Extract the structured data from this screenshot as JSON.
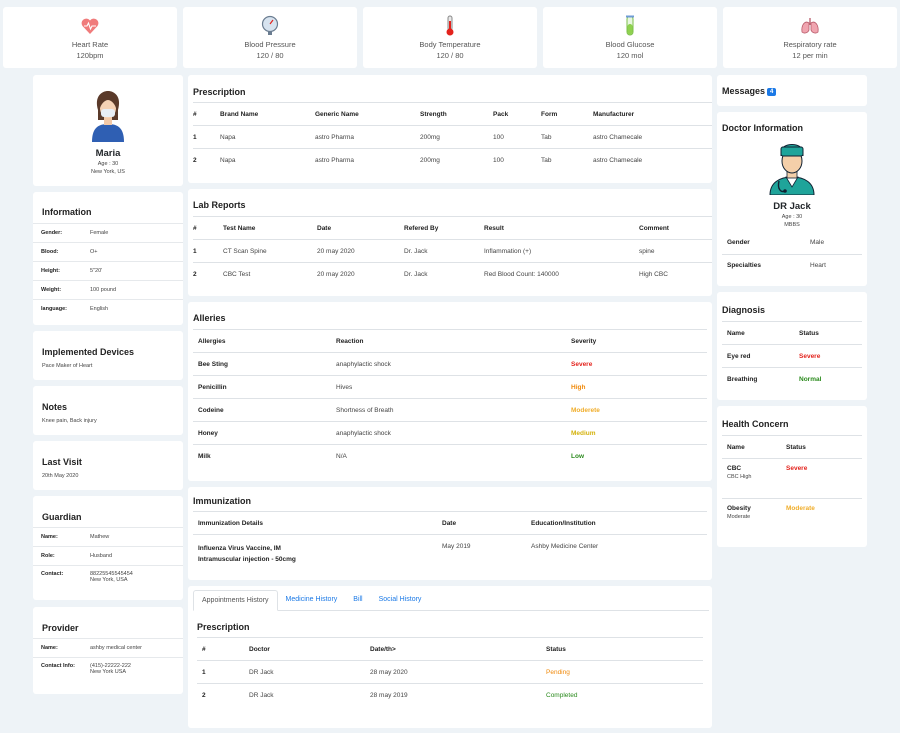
{
  "vitals": [
    {
      "label": "Heart Rate",
      "value": "120bpm",
      "icon": "heart-icon"
    },
    {
      "label": "Blood Pressure",
      "value": "120 / 80",
      "icon": "gauge-icon"
    },
    {
      "label": "Body Temperature",
      "value": "120 / 80",
      "icon": "thermometer-icon"
    },
    {
      "label": "Blood Glucose",
      "value": "120 mol",
      "icon": "test-tube-icon"
    },
    {
      "label": "Respiratory rate",
      "value": "12 per min",
      "icon": "lungs-icon"
    }
  ],
  "patient": {
    "name": "Maria",
    "age": "Age : 30",
    "location": "New York, US"
  },
  "information": {
    "title": "Information",
    "rows": [
      {
        "k": "Gender:",
        "v": "Female"
      },
      {
        "k": "Blood:",
        "v": "O+"
      },
      {
        "k": "Height:",
        "v": "5\"20'"
      },
      {
        "k": "Weight:",
        "v": "100 pound"
      },
      {
        "k": "language:",
        "v": "English"
      }
    ]
  },
  "devices": {
    "title": "Implemented Devices",
    "text": "Pace Maker of Heart"
  },
  "notes": {
    "title": "Notes",
    "text": "Knee pain, Back injury"
  },
  "last_visit": {
    "title": "Last Visit",
    "text": "20th May 2020"
  },
  "guardian": {
    "title": "Guardian",
    "rows": [
      {
        "k": "Name:",
        "v": "Mathew"
      },
      {
        "k": "Role:",
        "v": "Husband"
      },
      {
        "k": "Contact:",
        "v": "88225545545454",
        "v2": "New York, USA"
      }
    ]
  },
  "provider": {
    "title": "Provider",
    "rows": [
      {
        "k": "Name:",
        "v": "ashby medical center"
      },
      {
        "k": "Contact Info:",
        "v": "(415)-22222-222",
        "v2": "New York USA"
      }
    ]
  },
  "prescription": {
    "title": "Prescription",
    "headers": [
      "#",
      "Brand Name",
      "Generic Name",
      "Strength",
      "Pack",
      "Form",
      "Manufacturer"
    ],
    "rows": [
      [
        "1",
        "Napa",
        "astro Pharma",
        "200mg",
        "100",
        "Tab",
        "astro Chamecale"
      ],
      [
        "2",
        "Napa",
        "astro Pharma",
        "200mg",
        "100",
        "Tab",
        "astro Chamecale"
      ]
    ]
  },
  "lab": {
    "title": "Lab Reports",
    "headers": [
      "#",
      "Test Name",
      "Date",
      "Refered By",
      "Result",
      "Comment"
    ],
    "rows": [
      [
        "1",
        "CT Scan Spine",
        "20 may 2020",
        "Dr. Jack",
        "Inflammation (+)",
        "spine"
      ],
      [
        "2",
        "CBC Test",
        "20 may 2020",
        "Dr. Jack",
        "Red Blood Count: 140000",
        "High CBC"
      ]
    ]
  },
  "allergies": {
    "title": "Alleries",
    "headers": [
      "Allergies",
      "Reaction",
      "Severity"
    ],
    "rows": [
      {
        "name": "Bee Sting",
        "reaction": "anaphylactic shock",
        "severity": "Severe"
      },
      {
        "name": "Penicillin",
        "reaction": "Hives",
        "severity": "High"
      },
      {
        "name": "Codeine",
        "reaction": "Shortness of Breath",
        "severity": "Moderete"
      },
      {
        "name": "Honey",
        "reaction": "anaphylactic shock",
        "severity": "Medium"
      },
      {
        "name": "Milk",
        "reaction": "N/A",
        "severity": "Low"
      }
    ]
  },
  "immunization": {
    "title": "Immunization",
    "headers": [
      "Immunization Details",
      "Date",
      "Education/Institution"
    ],
    "row": {
      "line1": "Influenza Virus Vaccine, IM",
      "line2": "Intramuscular injection - 50cmg",
      "date": "May 2019",
      "inst": "Ashby Medicine Center"
    }
  },
  "tabs": [
    "Appointments History",
    "Medicine History",
    "Bill",
    "Social History"
  ],
  "appointments": {
    "title": "Prescription",
    "headers": [
      "#",
      "Doctor",
      "Date/th>",
      "Status"
    ],
    "rows": [
      [
        "1",
        "DR Jack",
        "28 may 2020",
        "Pending"
      ],
      [
        "2",
        "DR Jack",
        "28 may 2019",
        "Completed"
      ]
    ]
  },
  "messages": {
    "title": "Messages",
    "count": "4"
  },
  "doctor": {
    "title": "Doctor Information",
    "name": "DR Jack",
    "age": "Age : 30",
    "degree": "MBBS",
    "rows": [
      {
        "k": "Gender",
        "v": "Male"
      },
      {
        "k": "Specialties",
        "v": "Heart"
      }
    ]
  },
  "diagnosis": {
    "title": "Diagnosis",
    "headers": [
      "Name",
      "Status"
    ],
    "rows": [
      [
        "Eye red",
        "Severe"
      ],
      [
        "Breathing",
        "Normal"
      ]
    ]
  },
  "concern": {
    "title": "Health Concern",
    "headers": [
      "Name",
      "Status"
    ],
    "rows": [
      {
        "name": "CBC",
        "sub": "CBC High",
        "status": "Severe"
      },
      {
        "name": "Obesity",
        "sub": "Moderate",
        "status": "Moderate"
      }
    ]
  },
  "colors": {
    "accent": "#1b79e6",
    "severe": "#e3221c",
    "high": "#f08a0c",
    "moderate": "#f0ad2a",
    "medium": "#d4b20c",
    "low": "#2a8a1c"
  }
}
